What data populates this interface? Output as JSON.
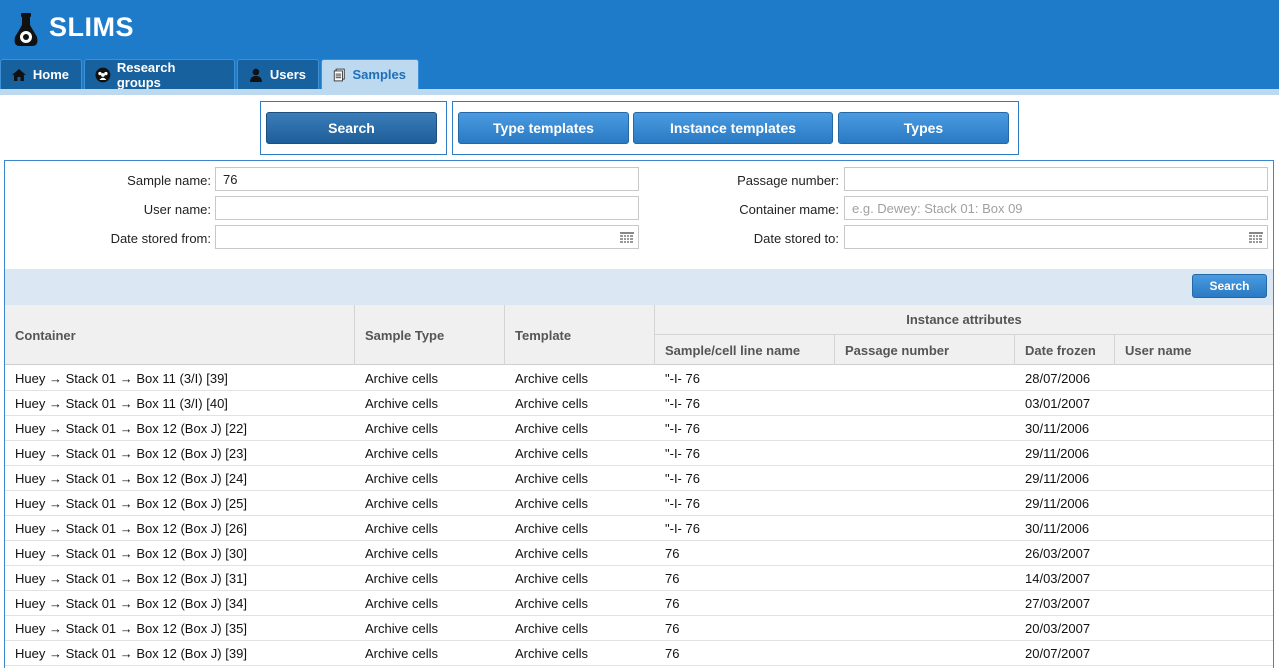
{
  "app": {
    "title": "SLIMS"
  },
  "tabs": [
    {
      "label": "Home",
      "icon": "home-icon"
    },
    {
      "label": "Research groups",
      "icon": "group-icon"
    },
    {
      "label": "Users",
      "icon": "user-icon"
    },
    {
      "label": "Samples",
      "icon": "documents-icon",
      "active": true
    }
  ],
  "toolbar": {
    "search": "Search",
    "type_templates": "Type templates",
    "instance_templates": "Instance templates",
    "types": "Types"
  },
  "form": {
    "sample_name_label": "Sample name:",
    "sample_name_value": "76",
    "user_name_label": "User name:",
    "user_name_value": "",
    "date_from_label": "Date stored from:",
    "date_from_value": "",
    "passage_label": "Passage number:",
    "passage_value": "",
    "container_label": "Container mame:",
    "container_placeholder": "e.g. Dewey: Stack 01: Box 09",
    "date_to_label": "Date stored to:",
    "date_to_value": "",
    "search_button": "Search"
  },
  "table": {
    "headers": {
      "container": "Container",
      "sample_type": "Sample Type",
      "template": "Template",
      "instance_attributes": "Instance attributes",
      "sample_cell_line": "Sample/cell line name",
      "passage_number": "Passage number",
      "date_frozen": "Date frozen",
      "user_name": "User name"
    },
    "rows": [
      {
        "container": "Huey → Stack 01 → Box 11 (3/I) [39]",
        "sample_type": "Archive cells",
        "template": "Archive cells",
        "name": "\"-I- 76",
        "passage": "",
        "date": "28/07/2006",
        "user": ""
      },
      {
        "container": "Huey → Stack 01 → Box 11 (3/I) [40]",
        "sample_type": "Archive cells",
        "template": "Archive cells",
        "name": "\"-I- 76",
        "passage": "",
        "date": "03/01/2007",
        "user": ""
      },
      {
        "container": "Huey → Stack 01 → Box 12 (Box J) [22]",
        "sample_type": "Archive cells",
        "template": "Archive cells",
        "name": "\"-I- 76",
        "passage": "",
        "date": "30/11/2006",
        "user": ""
      },
      {
        "container": "Huey → Stack 01 → Box 12 (Box J) [23]",
        "sample_type": "Archive cells",
        "template": "Archive cells",
        "name": "\"-I- 76",
        "passage": "",
        "date": "29/11/2006",
        "user": ""
      },
      {
        "container": "Huey → Stack 01 → Box 12 (Box J) [24]",
        "sample_type": "Archive cells",
        "template": "Archive cells",
        "name": "\"-I- 76",
        "passage": "",
        "date": "29/11/2006",
        "user": ""
      },
      {
        "container": "Huey → Stack 01 → Box 12 (Box J) [25]",
        "sample_type": "Archive cells",
        "template": "Archive cells",
        "name": "\"-I- 76",
        "passage": "",
        "date": "29/11/2006",
        "user": ""
      },
      {
        "container": "Huey → Stack 01 → Box 12 (Box J) [26]",
        "sample_type": "Archive cells",
        "template": "Archive cells",
        "name": "\"-I- 76",
        "passage": "",
        "date": "30/11/2006",
        "user": ""
      },
      {
        "container": "Huey → Stack 01 → Box 12 (Box J) [30]",
        "sample_type": "Archive cells",
        "template": "Archive cells",
        "name": "76",
        "passage": "",
        "date": "26/03/2007",
        "user": ""
      },
      {
        "container": "Huey → Stack 01 → Box 12 (Box J) [31]",
        "sample_type": "Archive cells",
        "template": "Archive cells",
        "name": "76",
        "passage": "",
        "date": "14/03/2007",
        "user": ""
      },
      {
        "container": "Huey → Stack 01 → Box 12 (Box J) [34]",
        "sample_type": "Archive cells",
        "template": "Archive cells",
        "name": "76",
        "passage": "",
        "date": "27/03/2007",
        "user": ""
      },
      {
        "container": "Huey → Stack 01 → Box 12 (Box J) [35]",
        "sample_type": "Archive cells",
        "template": "Archive cells",
        "name": "76",
        "passage": "",
        "date": "20/03/2007",
        "user": ""
      },
      {
        "container": "Huey → Stack 01 → Box 12 (Box J) [39]",
        "sample_type": "Archive cells",
        "template": "Archive cells",
        "name": "76",
        "passage": "",
        "date": "20/07/2007",
        "user": ""
      }
    ]
  },
  "colors": {
    "header_blue": "#1e7bca",
    "tab_active_bg": "#bcd9f0",
    "accent": "#2a7ac4"
  }
}
